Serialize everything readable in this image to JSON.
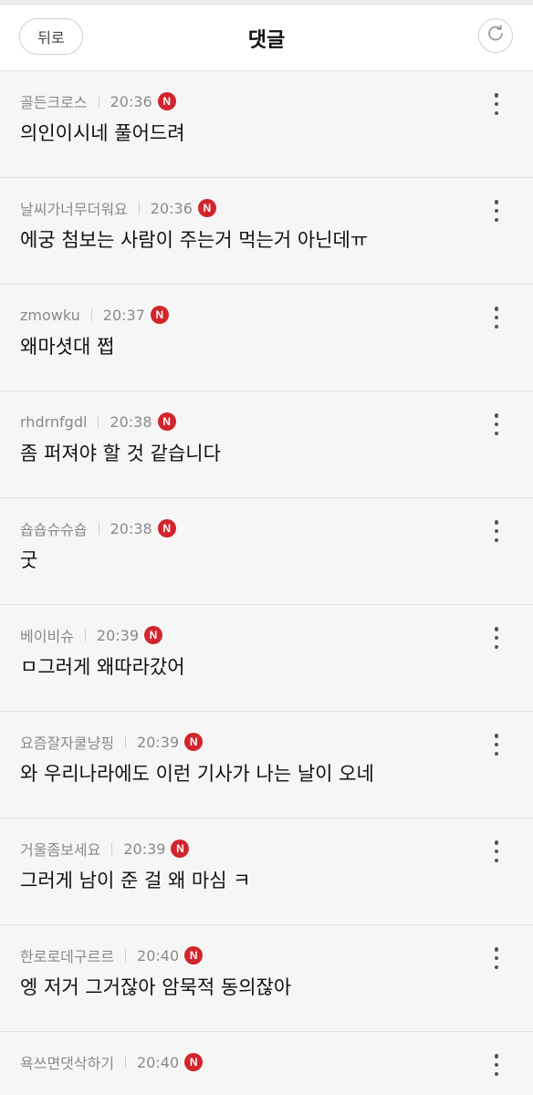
{
  "header": {
    "back_label": "뒤로",
    "title": "댓글",
    "refresh_icon": "refresh-icon"
  },
  "badge_label": "N",
  "comments": [
    {
      "author": "골든크로스",
      "time": "20:36",
      "text": "의인이시네 풀어드려"
    },
    {
      "author": "날씨가너무더워요",
      "time": "20:36",
      "text": "에궁 첨보는 사람이 주는거 먹는거 아닌데ㅠ"
    },
    {
      "author": "zmowku",
      "time": "20:37",
      "text": "왜마셧대 쩝"
    },
    {
      "author": "rhdrnfgdl",
      "time": "20:38",
      "text": "좀 퍼져야 할 것 같습니다"
    },
    {
      "author": "숍숍슈슈숍",
      "time": "20:38",
      "text": "굿"
    },
    {
      "author": "베이비슈",
      "time": "20:39",
      "text": "ㅁ그러게 왜따라갔어"
    },
    {
      "author": "요즘잘자쿨냥핑",
      "time": "20:39",
      "text": "와 우리나라에도 이런 기사가 나는 날이 오네"
    },
    {
      "author": "거울좀보세요",
      "time": "20:39",
      "text": "그러게 남이 준 걸 왜 마심 ㅋ"
    },
    {
      "author": "한로로데구르르",
      "time": "20:40",
      "text": "엥 저거 그거잖아 암묵적 동의잖아"
    },
    {
      "author": "욕쓰면댓삭하기",
      "time": "20:40",
      "text": ""
    }
  ],
  "colors": {
    "badge": "#d1252c",
    "background": "#f6f6f6",
    "meta_text": "#8a8a8a"
  }
}
